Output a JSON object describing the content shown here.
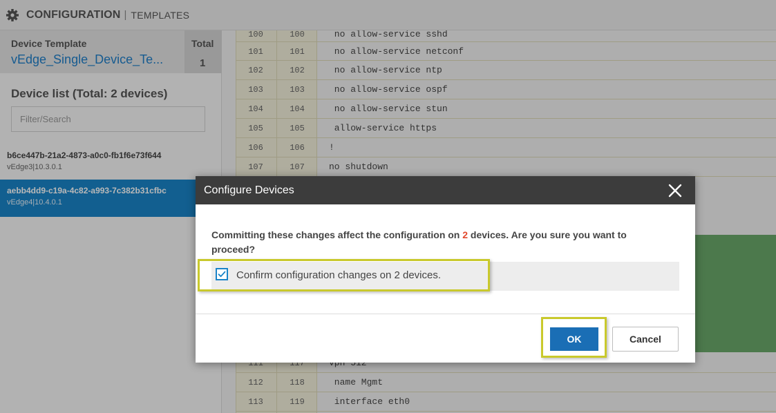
{
  "header": {
    "title": "CONFIGURATION",
    "separator": "|",
    "subtitle": "TEMPLATES",
    "icon": "gear-icon"
  },
  "sidebar": {
    "template_label": "Device Template",
    "template_name": "vEdge_Single_Device_Te...",
    "total_label": "Total",
    "total_value": "1",
    "device_list_title": "Device list (Total: 2 devices)",
    "search_placeholder": "Filter/Search",
    "devices": [
      {
        "id": "b6ce447b-21a2-4873-a0c0-fb1f6e73f644",
        "meta": "vEdge3|10.3.0.1",
        "selected": false
      },
      {
        "id": "aebb4dd9-c19a-4c82-a993-7c382b31cfbc",
        "meta": "vEdge4|10.4.0.1",
        "selected": true
      }
    ]
  },
  "code": {
    "rows": [
      {
        "left": "100",
        "right": "100",
        "text": " no allow-service sshd"
      },
      {
        "left": "101",
        "right": "101",
        "text": " no allow-service netconf"
      },
      {
        "left": "102",
        "right": "102",
        "text": " no allow-service ntp"
      },
      {
        "left": "103",
        "right": "103",
        "text": " no allow-service ospf"
      },
      {
        "left": "104",
        "right": "104",
        "text": " no allow-service stun"
      },
      {
        "left": "105",
        "right": "105",
        "text": " allow-service https"
      },
      {
        "left": "106",
        "right": "106",
        "text": "!"
      },
      {
        "left": "107",
        "right": "107",
        "text": "no shutdown"
      },
      {
        "left": "111",
        "right": "117",
        "text": "vpn 512"
      },
      {
        "left": "112",
        "right": "118",
        "text": " name Mgmt"
      },
      {
        "left": "113",
        "right": "119",
        "text": " interface eth0"
      }
    ],
    "added_color": "#6aa86a"
  },
  "modal": {
    "title": "Configure Devices",
    "message_before": "Committing these changes affect the configuration on ",
    "message_count": "2",
    "message_after": " devices. Are you sure you want to proceed?",
    "confirm_label": "Confirm configuration changes on 2 devices.",
    "confirm_checked": true,
    "ok_label": "OK",
    "cancel_label": "Cancel",
    "highlight_color": "#c9c92c",
    "accent_color": "#1a6eb5"
  }
}
